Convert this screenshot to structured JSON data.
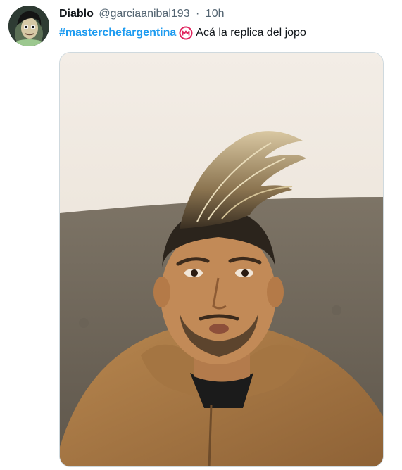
{
  "tweet": {
    "author": {
      "display_name": "Diablo",
      "handle": "@garciaanibal193",
      "separator": "·",
      "time": "10h"
    },
    "text": {
      "hashtag": "#masterchefargentina",
      "hashflag_icon": "masterchef-logo-icon",
      "body": "Acá la replica del jopo"
    },
    "media": {
      "type": "photo"
    }
  },
  "colors": {
    "link": "#1d9bf0",
    "secondary_text": "#536471",
    "primary_text": "#0f1419",
    "media_border": "#cfd9de",
    "hashflag": "#e0245e"
  }
}
